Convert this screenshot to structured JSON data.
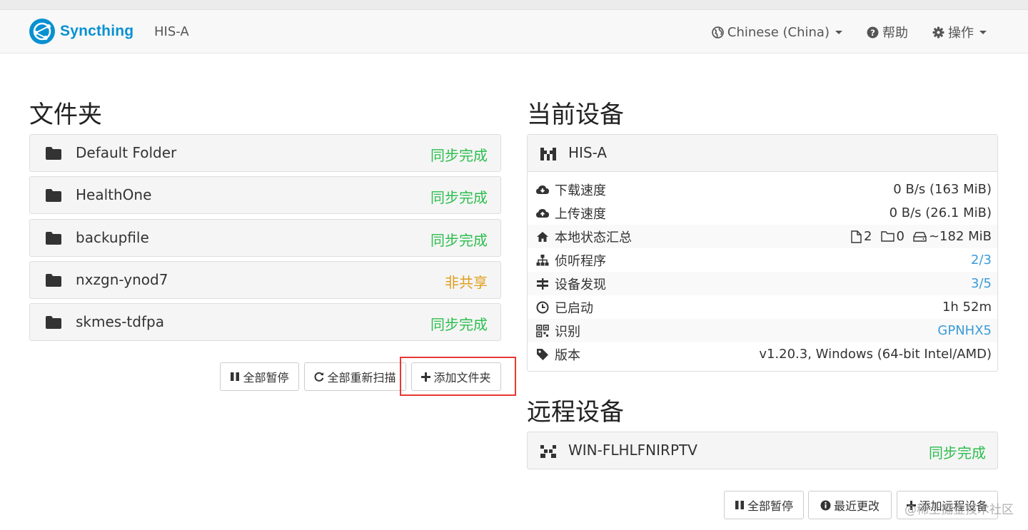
{
  "navbar": {
    "brand": "Syncthing",
    "device_name": "HIS-A",
    "language": "Chinese (China)",
    "help": "帮助",
    "actions": "操作"
  },
  "folders": {
    "title": "文件夹",
    "items": [
      {
        "name": "Default Folder",
        "status": "同步完成",
        "status_kind": "ok"
      },
      {
        "name": "HealthOne",
        "status": "同步完成",
        "status_kind": "ok"
      },
      {
        "name": "backupfile",
        "status": "同步完成",
        "status_kind": "ok"
      },
      {
        "name": "nxzgn-ynod7",
        "status": "非共享",
        "status_kind": "warn"
      },
      {
        "name": "skmes-tdfpa",
        "status": "同步完成",
        "status_kind": "ok"
      }
    ],
    "buttons": {
      "pause_all": "全部暂停",
      "rescan_all": "全部重新扫描",
      "add_folder": "添加文件夹"
    }
  },
  "this_device": {
    "title": "当前设备",
    "name": "HIS-A",
    "rows": {
      "download_label": "下载速度",
      "download_value": "0 B/s (163 MiB)",
      "upload_label": "上传速度",
      "upload_value": "0 B/s (26.1 MiB)",
      "local_state_label": "本地状态汇总",
      "files": "2",
      "dirs": "0",
      "size": "~182 MiB",
      "listeners_label": "侦听程序",
      "listeners_value": "2/3",
      "discovery_label": "设备发现",
      "discovery_value": "3/5",
      "uptime_label": "已启动",
      "uptime_value": "1h 52m",
      "id_label": "识别",
      "id_value": "GPNHX5",
      "version_label": "版本",
      "version_value": "v1.20.3, Windows (64-bit Intel/AMD)"
    }
  },
  "remote_devices": {
    "title": "远程设备",
    "items": [
      {
        "name": "WIN-FLHLFNIRPTV",
        "status": "同步完成"
      }
    ],
    "buttons": {
      "pause_all": "全部暂停",
      "recent_changes": "最近更改",
      "add_remote": "添加远程设备"
    }
  },
  "watermark": "@稀土掘金技术社区",
  "colors": {
    "brand": "#0891d1",
    "ok": "#2cbe4e",
    "warn": "#e09e1c",
    "link": "#3a9bd9",
    "highlight": "#e53935"
  }
}
